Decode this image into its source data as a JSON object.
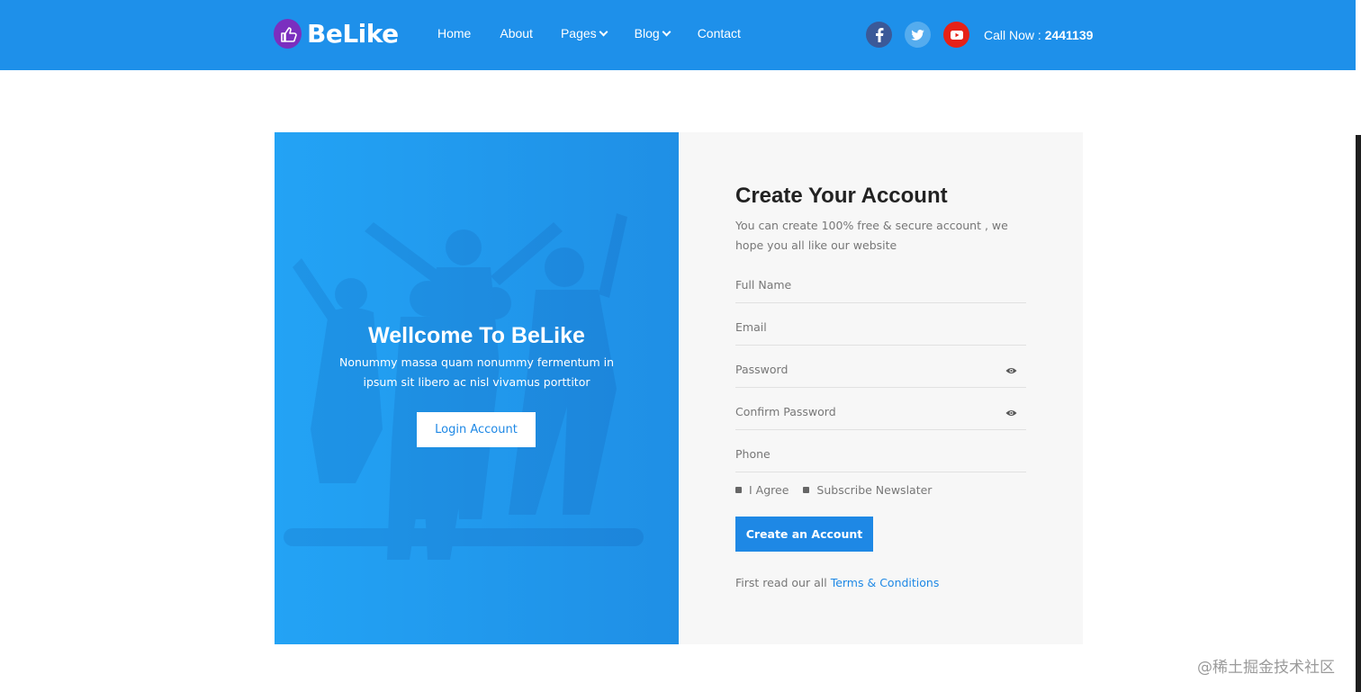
{
  "header": {
    "logo_text": "BeLike",
    "nav": [
      {
        "label": "Home"
      },
      {
        "label": "About"
      },
      {
        "label": "Pages"
      },
      {
        "label": "Blog"
      },
      {
        "label": "Contact"
      }
    ],
    "socials": [
      {
        "name": "facebook-icon",
        "glyph": "f",
        "color": "#3b5998"
      },
      {
        "name": "twitter-icon",
        "glyph": "t",
        "color": "#55acee"
      },
      {
        "name": "youtube-icon",
        "glyph": "▶",
        "color": "#e62117"
      }
    ],
    "call_label": "Call Now :",
    "call_number": "2441139"
  },
  "welcome": {
    "title": "Wellcome To BeLike",
    "subtitle": "Nonummy massa quam nonummy fermentum in ipsum sit libero ac nisl vivamus porttitor",
    "login_button": "Login Account"
  },
  "form": {
    "title": "Create Your Account",
    "description": "You can create 100% free & secure account , we hope you all like our website",
    "fields": {
      "full_name_placeholder": "Full Name",
      "email_placeholder": "Email",
      "password_placeholder": "Password",
      "confirm_password_placeholder": "Confirm Password",
      "phone_placeholder": "Phone"
    },
    "agree_label": "I Agree",
    "subscribe_label": "Subscribe Newslater",
    "submit_label": "Create an Account",
    "terms_prefix": "First read our all",
    "terms_link": "Terms & Conditions"
  },
  "watermark": "@稀土掘金技术社区",
  "colors": {
    "primary": "#1e90ea",
    "button_blue": "#1e88e5",
    "panel_gray": "#f7f7f7"
  }
}
